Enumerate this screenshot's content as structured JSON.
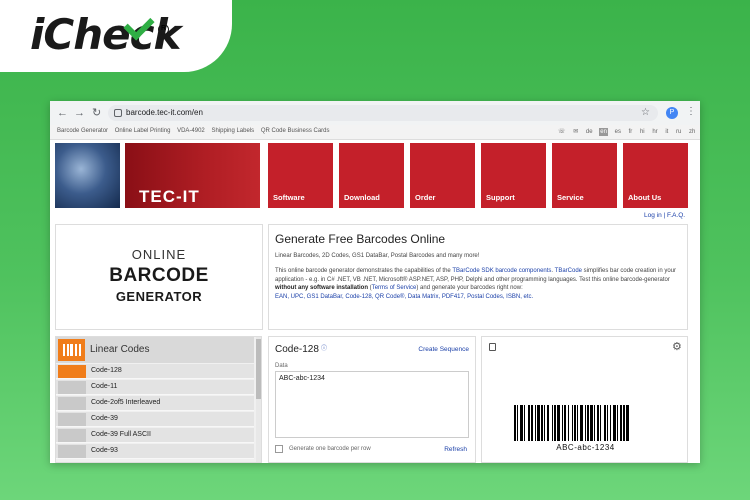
{
  "brand": {
    "logo_text": "iCheck",
    "registered": "R"
  },
  "browser": {
    "url": "barcode.tec-it.com/en",
    "avatar_letter": "P",
    "nav": {
      "back": "←",
      "forward": "→",
      "reload": "↻"
    }
  },
  "topnav": {
    "links": [
      "Barcode Generator",
      "Online Label Printing",
      "VDA-4902",
      "Shipping Labels",
      "QR Code Business Cards"
    ],
    "languages": [
      "de",
      "en",
      "es",
      "fr",
      "hi",
      "hr",
      "it",
      "ru",
      "zh"
    ],
    "active_language": "en"
  },
  "banner": {
    "brand": "TEC-IT",
    "tiles": [
      "Software",
      "Download",
      "Order",
      "Support",
      "Service",
      "About Us"
    ],
    "login": "Log in",
    "faq": "F.A.Q."
  },
  "online_box": {
    "line1": "ONLINE",
    "line2": "BARCODE",
    "line3": "GENERATOR"
  },
  "intro": {
    "title": "Generate Free Barcodes Online",
    "subtitle": "Linear Barcodes, 2D Codes, GS1 DataBar, Postal Barcodes and many more!",
    "p1": "This online barcode generator demonstrates the capabilities of the ",
    "link_sdk": "TBarCode SDK",
    "link_components": "barcode components",
    "link_tbarcode": "TBarCode",
    "p2": " simplifies bar code creation in your application - e.g. in C# .NET, VB .NET, Microsoft® ASP.NET, ASP, PHP, Delphi and other programming languages. Test this online barcode-generator ",
    "bold": "without any software installation",
    "link_terms": "Terms of Service",
    "p3": ") and generate your barcodes right now:",
    "code_links": "EAN, UPC, GS1 DataBar, Code-128, QR Code®, Data Matrix, PDF417, Postal Codes, ISBN, etc."
  },
  "codes_panel": {
    "title": "Linear Codes",
    "items": [
      "Code-128",
      "Code-11",
      "Code-2of5 Interleaved",
      "Code-39",
      "Code-39 Full ASCII",
      "Code-93"
    ],
    "selected": "Code-128"
  },
  "data_panel": {
    "title": "Code-128",
    "info": "ⓘ",
    "sequence": "Create Sequence",
    "data_label": "Data",
    "data_value": "ABC-abc-1234",
    "checkbox_label": "Generate one barcode per row",
    "refresh": "Refresh"
  },
  "barcode_panel": {
    "text": "ABC-abc-1234"
  }
}
